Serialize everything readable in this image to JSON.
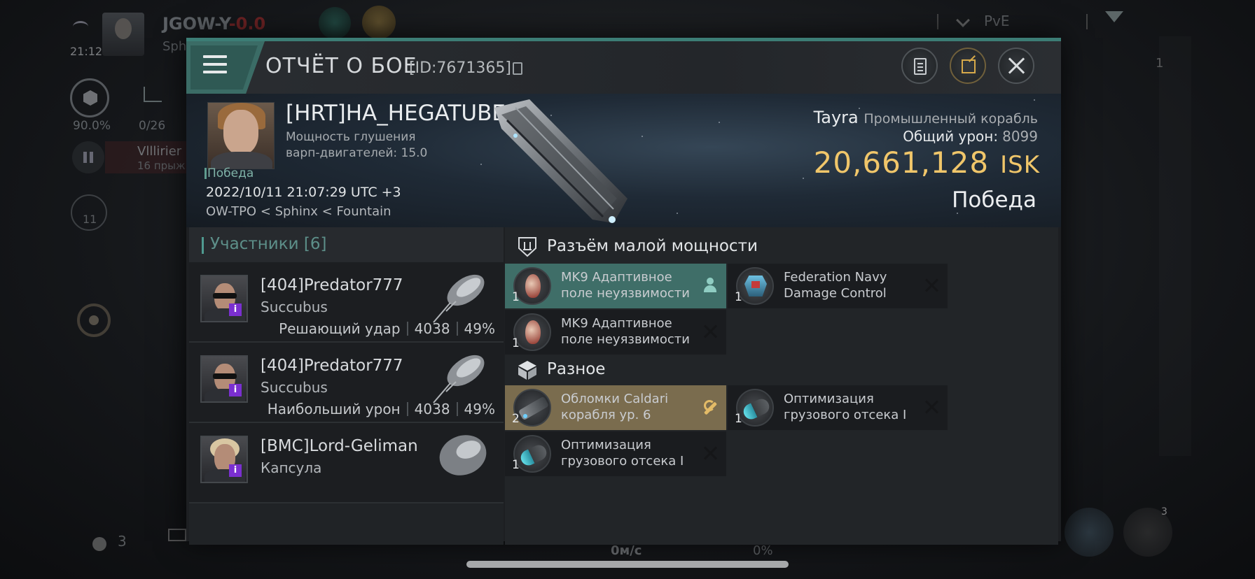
{
  "hud": {
    "system_name": "JGOW-Y",
    "system_security": "-0.0",
    "system_sub": "Sph",
    "clock": "21:12",
    "cargo_pct": "90.0%",
    "chart_count": "0/26",
    "pilot_chip_name": "Vlllirier",
    "pilot_chip_sub": "16 прыж.",
    "layers_num": "11",
    "mode_label": "PvE",
    "people_count": "3",
    "speed": "0м/с",
    "percent": "0%",
    "right_counter": "1",
    "module_badge": "3"
  },
  "dialog": {
    "title": "ОТЧЁТ О БОЕ",
    "report_id": "[ID:7671365]"
  },
  "victim": {
    "name": "[HRT]HA_HEGATUBE",
    "stat_line1": "Мощность глушения",
    "stat_line2": "варп-двигателей: 15.0",
    "result_tag": "Победа",
    "date": "2022/10/11 21:07:29 UTC +3",
    "location": "OW-TPO < Sphinx < Fountain",
    "ship_name": "Tayra",
    "ship_class": "Промышленный корабль",
    "total_damage_label": "Общий урон:",
    "total_damage_value": "8099",
    "isk_value": "20,661,128",
    "isk_unit": "ISK",
    "outcome": "Победа"
  },
  "participants": {
    "title": "Участники [6]",
    "rows": [
      {
        "name": "[404]Predator777",
        "ship": "Succubus",
        "role": "Решающий удар",
        "damage": "4038",
        "percent": "49%"
      },
      {
        "name": "[404]Predator777",
        "ship": "Succubus",
        "role": "Наибольший урон",
        "damage": "4038",
        "percent": "49%"
      },
      {
        "name": "[BMC]Lord-Geliman",
        "ship": "Капсула"
      }
    ]
  },
  "items": {
    "section_low_slot": "Разъём малой мощности",
    "section_misc": "Разное",
    "low_slot": [
      {
        "name": "MK9 Адаптивное поле неуязвимости",
        "qty": "1",
        "status": "dropped"
      },
      {
        "name": "Federation Navy Damage Control",
        "qty": "1",
        "status": "destroyed"
      },
      {
        "name": "MK9 Адаптивное поле неуязвимости",
        "qty": "1",
        "status": "destroyed"
      }
    ],
    "misc": [
      {
        "name": "Обломки Caldari корабля ур. 6",
        "qty": "2",
        "status": "salvage"
      },
      {
        "name": "Оптимизация грузового отсека I",
        "qty": "1",
        "status": "destroyed"
      },
      {
        "name": "Оптимизация грузового отсека I",
        "qty": "1",
        "status": "destroyed"
      }
    ]
  },
  "colors": {
    "accent_teal": "#3c7d75",
    "isk_gold": "#f0c66a",
    "dropped_bg": "#3f6e68",
    "salvage_bg": "#7a6c4e",
    "badge_purple": "#7a2fd0"
  }
}
